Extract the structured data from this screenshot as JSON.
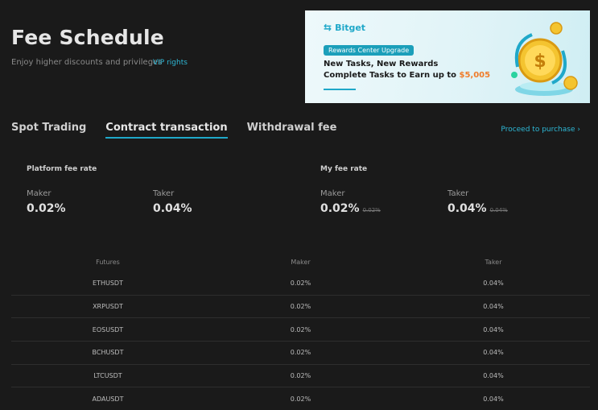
{
  "header": {
    "title": "Fee Schedule",
    "subtitle": "Enjoy higher discounts and privileges",
    "vip_link": "VIP rights"
  },
  "banner": {
    "brand": "Bitget",
    "badge": "Rewards Center Upgrade",
    "line1": "New Tasks, New Rewards",
    "line2_prefix": "Complete Tasks to Earn up to ",
    "line2_amount": "$5,005",
    "colors": {
      "accent": "#1fa8c9",
      "amount": "#f07c2a"
    }
  },
  "tabs": [
    {
      "label": "Spot Trading",
      "active": false
    },
    {
      "label": "Contract transaction",
      "active": true
    },
    {
      "label": "Withdrawal fee",
      "active": false
    }
  ],
  "proceed_link": "Proceed to purchase",
  "platform_fee": {
    "title": "Platform fee rate",
    "maker_label": "Maker",
    "maker_value": "0.02%",
    "taker_label": "Taker",
    "taker_value": "0.04%"
  },
  "my_fee": {
    "title": "My fee rate",
    "maker_label": "Maker",
    "maker_value": "0.02%",
    "maker_original": "0.02%",
    "taker_label": "Taker",
    "taker_value": "0.04%",
    "taker_original": "0.04%"
  },
  "table": {
    "headers": [
      "Futures",
      "Maker",
      "Taker"
    ],
    "rows": [
      [
        "ETHUSDT",
        "0.02%",
        "0.04%"
      ],
      [
        "XRPUSDT",
        "0.02%",
        "0.04%"
      ],
      [
        "EOSUSDT",
        "0.02%",
        "0.04%"
      ],
      [
        "BCHUSDT",
        "0.02%",
        "0.04%"
      ],
      [
        "LTCUSDT",
        "0.02%",
        "0.04%"
      ],
      [
        "ADAUSDT",
        "0.02%",
        "0.04%"
      ]
    ]
  },
  "colors": {
    "background": "#1a1a1a",
    "link": "#2eb8d6"
  }
}
